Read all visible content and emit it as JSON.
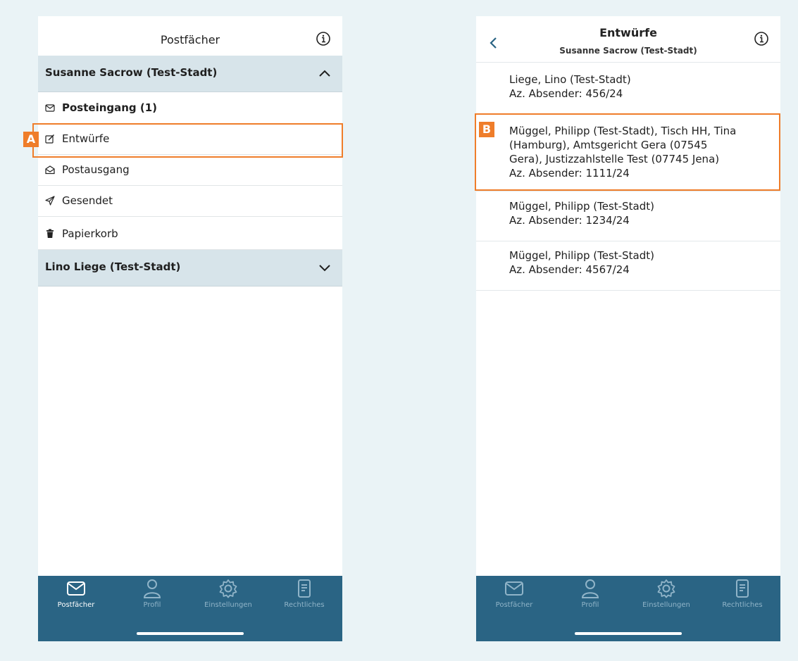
{
  "left": {
    "title": "Postfächer",
    "accounts": [
      {
        "name": "Susanne Sacrow (Test-Stadt)",
        "expanded": true
      },
      {
        "name": "Lino Liege (Test-Stadt)",
        "expanded": false
      }
    ],
    "folders": [
      {
        "label": "Posteingang (1)",
        "icon": "envelope-icon"
      },
      {
        "label": "Entwürfe",
        "icon": "edit-icon"
      },
      {
        "label": "Postausgang",
        "icon": "envelope-open-icon"
      },
      {
        "label": "Gesendet",
        "icon": "send-icon"
      },
      {
        "label": "Papierkorb",
        "icon": "trash-icon"
      }
    ],
    "highlight_label": "A"
  },
  "right": {
    "title": "Entwürfe",
    "subtitle": "Susanne Sacrow (Test-Stadt)",
    "highlight_label": "B",
    "messages": [
      {
        "lines": [
          "Liege, Lino (Test-Stadt)",
          "Az. Absender: 456/24"
        ]
      },
      {
        "lines": [
          "Müggel, Philipp (Test-Stadt), Tisch HH, Tina",
          "(Hamburg), Amtsgericht Gera (07545",
          "Gera), Justizzahlstelle Test (07745 Jena)",
          "Az. Absender: 1111/24"
        ]
      },
      {
        "lines": [
          "Müggel, Philipp (Test-Stadt)",
          "Az. Absender: 1234/24"
        ]
      },
      {
        "lines": [
          "Müggel, Philipp (Test-Stadt)",
          "Az. Absender: 4567/24"
        ]
      }
    ]
  },
  "tabs": [
    {
      "label": "Postfächer",
      "icon": "envelope-icon"
    },
    {
      "label": "Profil",
      "icon": "person-icon"
    },
    {
      "label": "Einstellungen",
      "icon": "gear-icon"
    },
    {
      "label": "Rechtliches",
      "icon": "document-icon"
    }
  ],
  "colors": {
    "background": "#eaf3f6",
    "tabbar": "#2a6484",
    "account_header": "#d7e4ea",
    "highlight": "#ef7d2a"
  }
}
